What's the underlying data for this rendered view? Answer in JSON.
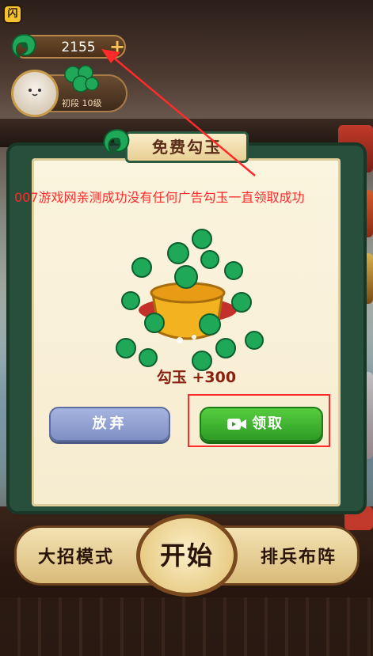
{
  "corner_icon": {
    "glyph": "闪"
  },
  "currency": {
    "value": "2155",
    "plus": "+",
    "jade_color": "#1fa858"
  },
  "player": {
    "rank": "初段 10级"
  },
  "popup": {
    "title": "免费勾玉",
    "reward": "勾玉 +300",
    "buttons": {
      "give_up": "放弃",
      "claim": "领取"
    }
  },
  "overlay_note": "007游戏网亲测成功没有任何广告勾玉一直领取成功",
  "bottom_menu": {
    "left": "大招模式",
    "center": "开始",
    "right": "排兵布阵"
  },
  "colors": {
    "annotation_red": "#ff2b2b",
    "claim_green": "#2e9c25",
    "give_up_blue": "#7f8fc3"
  }
}
